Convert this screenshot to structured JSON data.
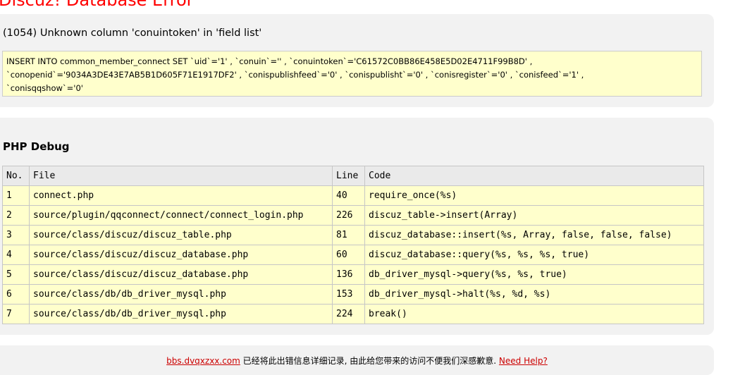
{
  "page_title": "Discuz! Database Error",
  "error": {
    "message": "(1054) Unknown column 'conuintoken' in 'field list'",
    "sql_lines": [
      "INSERT INTO common_member_connect SET `uid`='1' , `conuin`='' , `conuintoken`='C61572C0BB86E458E5D02E4711F99B8D' ,",
      "`conopenid`='9034A3DE43E7AB5B1D605F71E1917DF2' , `conispublishfeed`='0' , `conispublisht`='0' , `conisregister`='0' , `conisfeed`='1' ,",
      "`conisqqshow`='0'"
    ]
  },
  "debug": {
    "title": "PHP Debug",
    "columns": [
      "No.",
      "File",
      "Line",
      "Code"
    ],
    "rows": [
      {
        "no": "1",
        "file": "connect.php",
        "line": "40",
        "code": "require_once(%s)"
      },
      {
        "no": "2",
        "file": "source/plugin/qqconnect/connect/connect_login.php",
        "line": "226",
        "code": "discuz_table->insert(Array)"
      },
      {
        "no": "3",
        "file": "source/class/discuz/discuz_table.php",
        "line": "81",
        "code": "discuz_database::insert(%s, Array, false, false, false)"
      },
      {
        "no": "4",
        "file": "source/class/discuz/discuz_database.php",
        "line": "60",
        "code": "discuz_database::query(%s, %s, %s, true)"
      },
      {
        "no": "5",
        "file": "source/class/discuz/discuz_database.php",
        "line": "136",
        "code": "db_driver_mysql->query(%s, %s, true)"
      },
      {
        "no": "6",
        "file": "source/class/db/db_driver_mysql.php",
        "line": "153",
        "code": "db_driver_mysql->halt(%s, %d, %s)"
      },
      {
        "no": "7",
        "file": "source/class/db/db_driver_mysql.php",
        "line": "224",
        "code": "break()"
      }
    ]
  },
  "footer": {
    "site_link": "bbs.dvqxzxx.com",
    "message": " 已经将此出错信息详细记录, 由此给您带来的访问不便我们深感歉意. ",
    "help_link": "Need Help?"
  }
}
